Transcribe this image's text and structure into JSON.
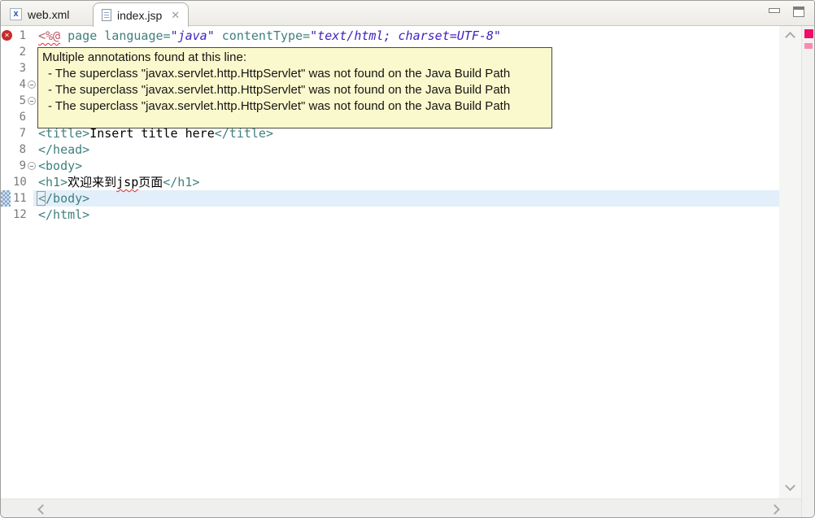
{
  "tabs": [
    {
      "label": "web.xml",
      "icon": "xml-file-icon",
      "active": false
    },
    {
      "label": "index.jsp",
      "icon": "jsp-file-icon",
      "active": true,
      "close_glyph": "✕"
    }
  ],
  "window_controls": {
    "minimize": "minimize-icon",
    "maximize": "maximize-icon"
  },
  "tooltip": {
    "title": "Multiple annotations found at this line:",
    "items": [
      "- The superclass \"javax.servlet.http.HttpServlet\" was not found on the Java Build Path",
      "- The superclass \"javax.servlet.http.HttpServlet\" was not found on the Java Build Path",
      "- The superclass \"javax.servlet.http.HttpServlet\" was not found on the Java Build Path"
    ]
  },
  "icons": {
    "error_glyph": "✕"
  },
  "editor": {
    "current_line": 11,
    "lines": [
      {
        "n": 1,
        "marker": "error",
        "segments": [
          {
            "t": "<%@",
            "c": "dir sq"
          },
          {
            "t": " ",
            "c": "pl"
          },
          {
            "t": "page",
            "c": "tag"
          },
          {
            "t": " ",
            "c": "pl"
          },
          {
            "t": "language=",
            "c": "tag"
          },
          {
            "t": "\"java\"",
            "c": "str"
          },
          {
            "t": " ",
            "c": "pl"
          },
          {
            "t": "contentType=",
            "c": "tag"
          },
          {
            "t": "\"text/html; charset=UTF-8\"",
            "c": "str"
          }
        ]
      },
      {
        "n": 2,
        "segments": []
      },
      {
        "n": 3,
        "segments": []
      },
      {
        "n": 4,
        "fold": true,
        "segments": []
      },
      {
        "n": 5,
        "fold": true,
        "segments": []
      },
      {
        "n": 6,
        "segments": []
      },
      {
        "n": 7,
        "segments": [
          {
            "t": "<title>",
            "c": "tag"
          },
          {
            "t": "Insert title here",
            "c": "pl"
          },
          {
            "t": "</title>",
            "c": "tag"
          }
        ]
      },
      {
        "n": 8,
        "segments": [
          {
            "t": "</head>",
            "c": "tag"
          }
        ]
      },
      {
        "n": 9,
        "fold": true,
        "segments": [
          {
            "t": "<body>",
            "c": "tag"
          }
        ]
      },
      {
        "n": 10,
        "segments": [
          {
            "t": "<h1>",
            "c": "tag"
          },
          {
            "t": "欢迎来到",
            "c": "pl"
          },
          {
            "t": "jsp",
            "c": "pl sq"
          },
          {
            "t": "页面",
            "c": "pl"
          },
          {
            "t": "</h1>",
            "c": "tag"
          }
        ]
      },
      {
        "n": 11,
        "marker": "occurrence",
        "segments": [
          {
            "t": "</body>",
            "c": "tag"
          }
        ]
      },
      {
        "n": 12,
        "segments": [
          {
            "t": "</html>",
            "c": "tag"
          }
        ]
      }
    ]
  },
  "colors": {
    "tag": "#3f7f7f",
    "attribute_value": "#3f1fbf",
    "jsp_directive": "#be5a6a",
    "tooltip_bg": "#faf9cd",
    "current_line_bg": "#e2effa",
    "error_icon": "#c62b29",
    "overview_error_marker": "#f20c6a",
    "overview_secondary_marker": "#f78ab5",
    "line_number": "#7a7a7a"
  }
}
